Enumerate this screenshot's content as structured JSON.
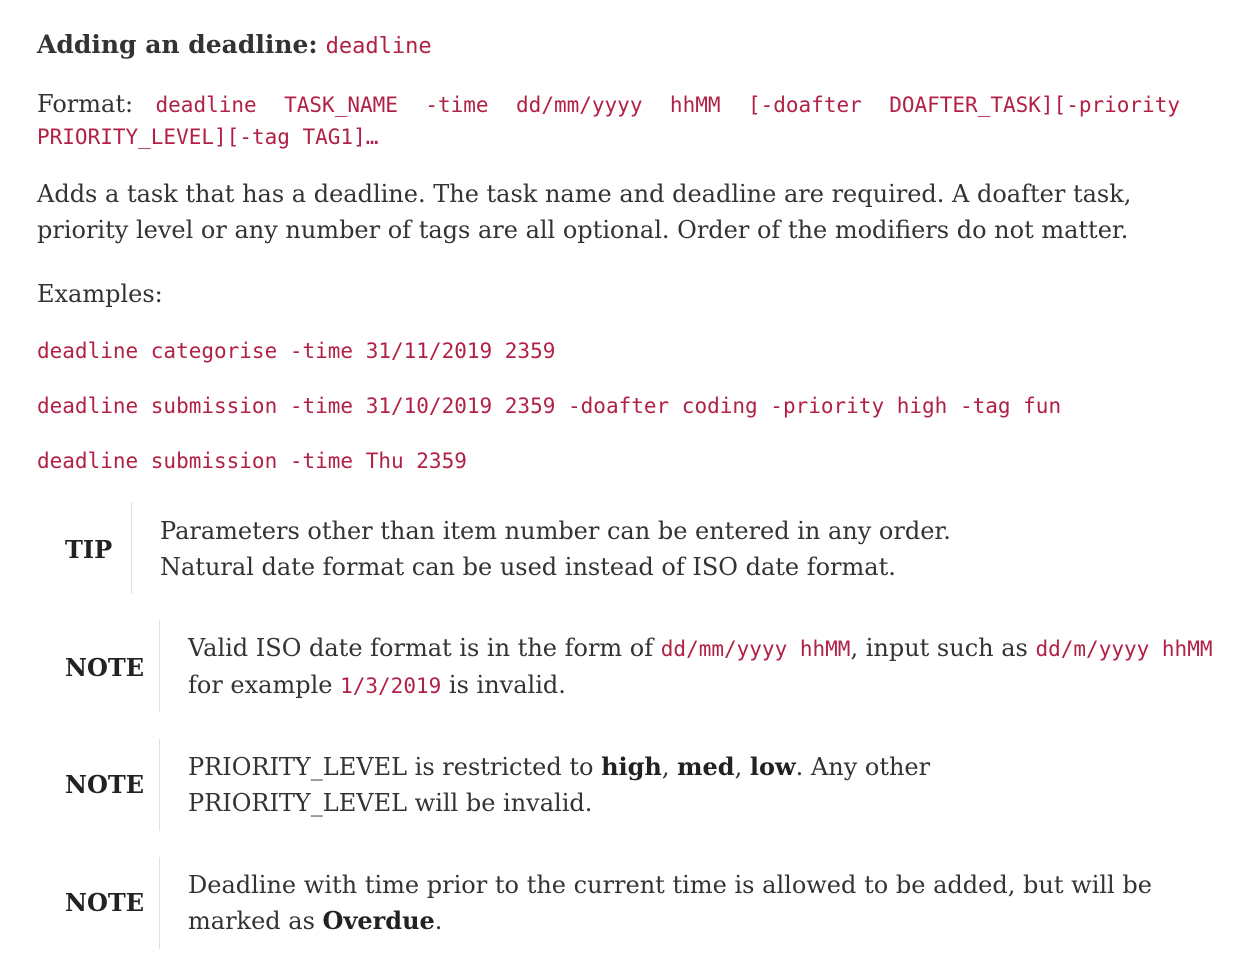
{
  "heading": {
    "title": "Adding an deadline:",
    "command": "deadline"
  },
  "format": {
    "label": "Format:",
    "syntax": "deadline TASK_NAME -time dd/mm/yyyy hhMM [-doafter DOAFTER_TASK][-priority PRIORITY_LEVEL][-tag TAG1]…"
  },
  "description": "Adds a task that has a deadline. The task name and deadline are required. A doafter task, priority level or any number of tags are all optional. Order of the modifiers do not matter.",
  "examples": {
    "label": "Examples:",
    "items": [
      "deadline categorise -time 31/11/2019 2359",
      "deadline submission -time 31/10/2019 2359 -doafter coding -priority high -tag fun",
      "deadline submission -time Thu 2359"
    ]
  },
  "tip": {
    "label": "TIP",
    "line1": "Parameters other than item number can be entered in any order.",
    "line2": "Natural date format can be used instead of ISO date format."
  },
  "note1": {
    "label": "NOTE",
    "t1": "Valid ISO date format is in the form of ",
    "c1": "dd/mm/yyyy hhMM",
    "t2": ", input such as ",
    "c2": "dd/m/yyyy hhMM",
    "t3": "for example ",
    "c3": "1/3/2019",
    "t4": " is invalid."
  },
  "note2": {
    "label": "NOTE",
    "t1": "PRIORITY_LEVEL is restricted to ",
    "b1": "high",
    "sep1": ", ",
    "b2": "med",
    "sep2": ", ",
    "b3": "low",
    "t2": ". Any other PRIORITY_LEVEL will be invalid."
  },
  "note3": {
    "label": "NOTE",
    "t1": "Deadline with time prior to the current time is allowed to be added, but will be marked as ",
    "b1": "Overdue",
    "t2": "."
  }
}
